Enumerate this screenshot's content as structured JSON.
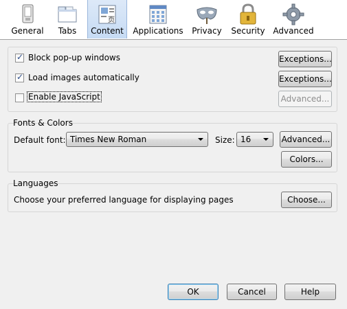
{
  "toolbar": {
    "items": [
      {
        "label": "General",
        "icon": "general-icon"
      },
      {
        "label": "Tabs",
        "icon": "tabs-icon"
      },
      {
        "label": "Content",
        "icon": "content-icon",
        "selected": true
      },
      {
        "label": "Applications",
        "icon": "applications-icon"
      },
      {
        "label": "Privacy",
        "icon": "privacy-mask-icon"
      },
      {
        "label": "Security",
        "icon": "padlock-icon"
      },
      {
        "label": "Advanced",
        "icon": "gear-icon"
      }
    ]
  },
  "content_group": {
    "block_popups": {
      "label": "Block pop-up windows",
      "checked": true,
      "button": "Exceptions..."
    },
    "load_images": {
      "label": "Load images automatically",
      "checked": true,
      "button": "Exceptions..."
    },
    "enable_js": {
      "label": "Enable JavaScript",
      "checked": false,
      "button": "Advanced..."
    }
  },
  "fonts_group": {
    "title": "Fonts & Colors",
    "default_font_label": "Default font:",
    "default_font_value": "Times New Roman",
    "size_label": "Size:",
    "size_value": "16",
    "advanced_button": "Advanced...",
    "colors_button": "Colors..."
  },
  "languages_group": {
    "title": "Languages",
    "description": "Choose your preferred language for displaying pages",
    "choose_button": "Choose..."
  },
  "footer": {
    "ok": "OK",
    "cancel": "Cancel",
    "help": "Help"
  },
  "colors": {
    "selected_tab_bg": "#c6dbf4",
    "window_bg": "#f0f0f0"
  }
}
